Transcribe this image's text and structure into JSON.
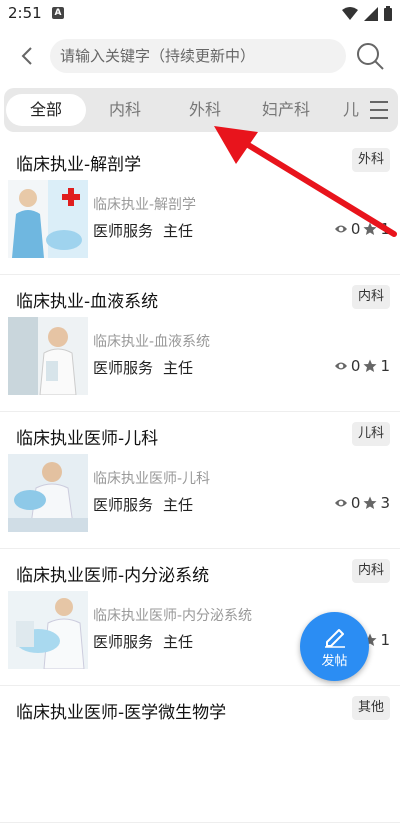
{
  "status": {
    "time": "2:51",
    "notification_letter": "A"
  },
  "search": {
    "placeholder": "请输入关键字（持续更新中）"
  },
  "tabs": [
    {
      "label": "全部",
      "active": true
    },
    {
      "label": "内科",
      "active": false
    },
    {
      "label": "外科",
      "active": false
    },
    {
      "label": "妇产科",
      "active": false
    },
    {
      "label": "儿",
      "active": false
    }
  ],
  "posts": [
    {
      "title": "临床执业-解剖学",
      "tag": "外科",
      "subtitle": "临床执业-解剖学",
      "service": "医师服务",
      "role": "主任",
      "views": "0",
      "stars": "1"
    },
    {
      "title": "临床执业-血液系统",
      "tag": "内科",
      "subtitle": "临床执业-血液系统",
      "service": "医师服务",
      "role": "主任",
      "views": "0",
      "stars": "1"
    },
    {
      "title": "临床执业医师-儿科",
      "tag": "儿科",
      "subtitle": "临床执业医师-儿科",
      "service": "医师服务",
      "role": "主任",
      "views": "0",
      "stars": "3"
    },
    {
      "title": "临床执业医师-内分泌系统",
      "tag": "内科",
      "subtitle": "临床执业医师-内分泌系统",
      "service": "医师服务",
      "role": "主任",
      "views": "0",
      "stars": "1"
    },
    {
      "title": "临床执业医师-医学微生物学",
      "tag": "其他",
      "subtitle": "",
      "service": "",
      "role": "",
      "views": "",
      "stars": ""
    }
  ],
  "fab": {
    "label": "发帖"
  },
  "colors": {
    "accent": "#2b8df3",
    "annotation": "#e8141c"
  }
}
